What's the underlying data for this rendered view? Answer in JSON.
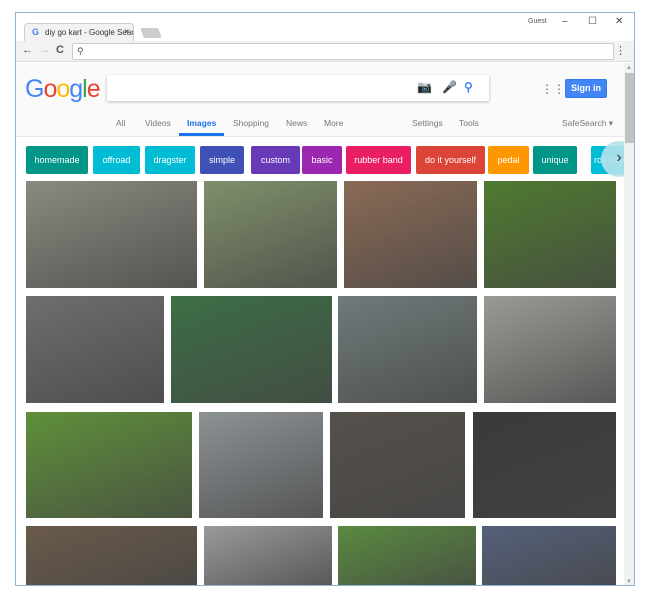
{
  "browser": {
    "tab_title": "diy go kart - Google Search",
    "profile": "Guest",
    "minimize": "–",
    "maximize": "☐",
    "close": "✕",
    "tab_close": "×",
    "back": "←",
    "forward": "→",
    "reload": "C",
    "menu": "⋮",
    "omnibox_value": ""
  },
  "header": {
    "logo": "Google",
    "search_value": "",
    "sign_in": "Sign in"
  },
  "nav_tabs": [
    {
      "label": "All"
    },
    {
      "label": "Videos"
    },
    {
      "label": "Images",
      "active": true
    },
    {
      "label": "Shopping"
    },
    {
      "label": "News"
    },
    {
      "label": "More"
    }
  ],
  "tools": {
    "settings": "Settings",
    "tools": "Tools",
    "safesearch": "SafeSearch ▾"
  },
  "chips": [
    {
      "label": "homemade",
      "color": "#009688"
    },
    {
      "label": "offroad",
      "color": "#00bcd4"
    },
    {
      "label": "dragster",
      "color": "#00bcd4"
    },
    {
      "label": "simple",
      "color": "#3f51b5"
    },
    {
      "label": "custom",
      "color": "#673ab7"
    },
    {
      "label": "basic",
      "color": "#9c27b0"
    },
    {
      "label": "rubber band",
      "color": "#e91e63"
    },
    {
      "label": "do it yourself",
      "color": "#db4437"
    },
    {
      "label": "pedal",
      "color": "#ff9800"
    },
    {
      "label": "unique",
      "color": "#009688"
    },
    {
      "label": "roll cage",
      "color": "#00bcd4"
    }
  ],
  "images": [
    {
      "alt": "go kart frame on pavement",
      "color": "#8a8a80"
    },
    {
      "alt": "silver go kart on sidewalk",
      "color": "#7f8f6a"
    },
    {
      "alt": "go kart in garage",
      "color": "#8a6a55"
    },
    {
      "alt": "red go karts on grass",
      "color": "#4f7a30"
    },
    {
      "alt": "red off-road kart",
      "color": "#6e6e6e"
    },
    {
      "alt": "green kart on grass",
      "color": "#3d6e45"
    },
    {
      "alt": "green kart on driveway",
      "color": "#6f7a7a"
    },
    {
      "alt": "black kart on driveway",
      "color": "#9a9a95"
    },
    {
      "alt": "green kart on lawn",
      "color": "#5f8f3a"
    },
    {
      "alt": "three-wheel kart",
      "color": "#8d9295"
    },
    {
      "alt": "black kart on trailer",
      "color": "#55504a"
    },
    {
      "alt": "batmobile kart",
      "color": "#3a3a3a"
    },
    {
      "alt": "kart in workshop",
      "color": "#6a5a4a"
    },
    {
      "alt": "kart seat frame",
      "color": "#9a9a9a"
    },
    {
      "alt": "blue engine kart on grass",
      "color": "#5a8a40"
    },
    {
      "alt": "blue kart frame",
      "color": "#55607a"
    }
  ]
}
